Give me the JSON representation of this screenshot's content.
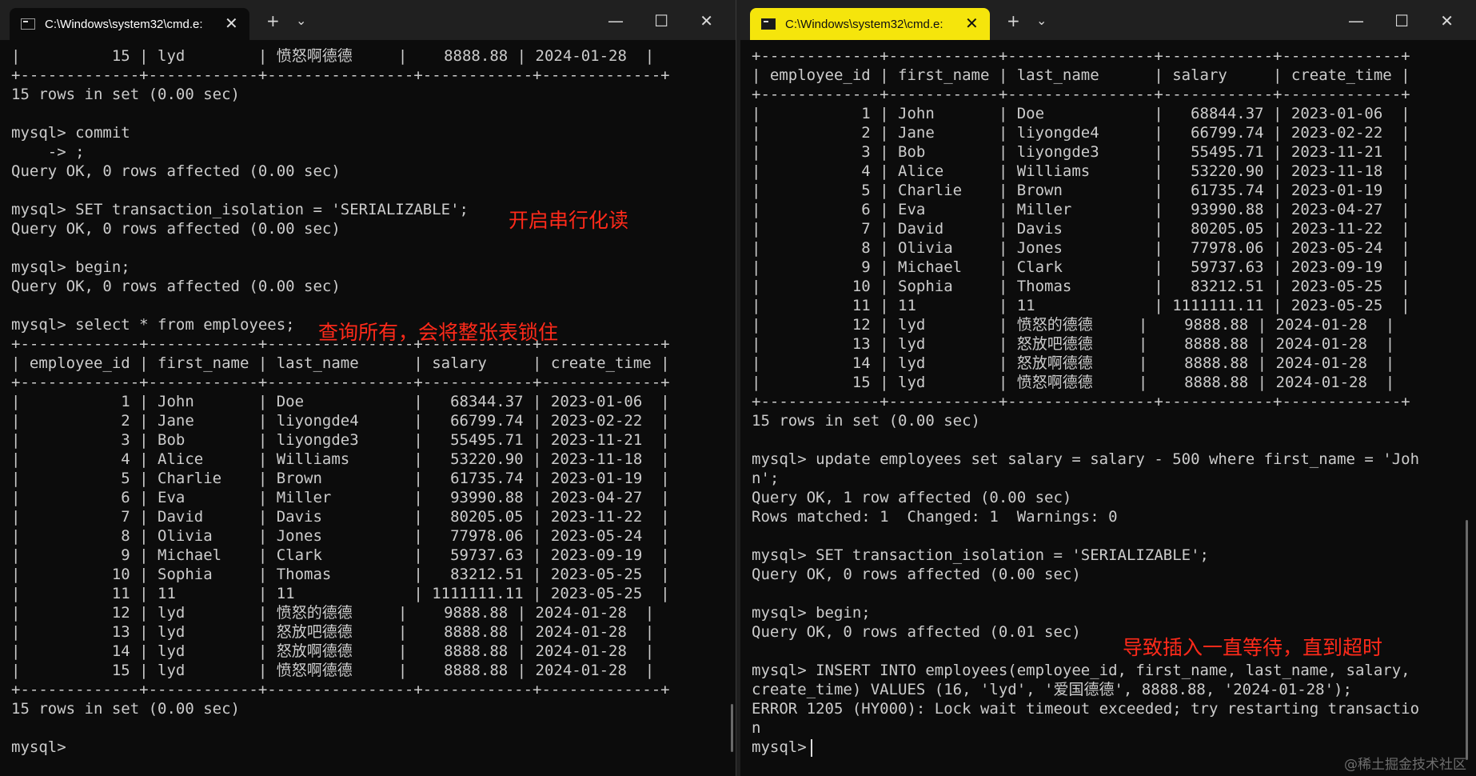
{
  "left_window": {
    "tab_title": "C:\\Windows\\system32\\cmd.e:",
    "tab_close": "✕",
    "new_tab": "+",
    "dropdown": "⌄",
    "minimize": "—",
    "maximize": "☐",
    "close": "✕",
    "lines": [
      "|          15 | lyd        | 愤怒啊德德     |    8888.88 | 2024-01-28  |",
      "+-------------+------------+----------------+------------+-------------+",
      "15 rows in set (0.00 sec)",
      "",
      "mysql> commit",
      "    -> ;",
      "Query OK, 0 rows affected (0.00 sec)",
      "",
      "mysql> SET transaction_isolation = 'SERIALIZABLE';",
      "Query OK, 0 rows affected (0.00 sec)",
      "",
      "mysql> begin;",
      "Query OK, 0 rows affected (0.00 sec)",
      "",
      "mysql> select * from employees;",
      "+-------------+------------+----------------+------------+-------------+",
      "| employee_id | first_name | last_name      | salary     | create_time |",
      "+-------------+------------+----------------+------------+-------------+",
      "|           1 | John       | Doe            |   68344.37 | 2023-01-06  |",
      "|           2 | Jane       | liyongde4      |   66799.74 | 2023-02-22  |",
      "|           3 | Bob        | liyongde3      |   55495.71 | 2023-11-21  |",
      "|           4 | Alice      | Williams       |   53220.90 | 2023-11-18  |",
      "|           5 | Charlie    | Brown          |   61735.74 | 2023-01-19  |",
      "|           6 | Eva        | Miller         |   93990.88 | 2023-04-27  |",
      "|           7 | David      | Davis          |   80205.05 | 2023-11-22  |",
      "|           8 | Olivia     | Jones          |   77978.06 | 2023-05-24  |",
      "|           9 | Michael    | Clark          |   59737.63 | 2023-09-19  |",
      "|          10 | Sophia     | Thomas         |   83212.51 | 2023-05-25  |",
      "|          11 | 11         | 11             | 1111111.11 | 2023-05-25  |",
      "|          12 | lyd        | 愤怒的德德     |    9888.88 | 2024-01-28  |",
      "|          13 | lyd        | 怒放吧德德     |    8888.88 | 2024-01-28  |",
      "|          14 | lyd        | 怒放啊德德     |    8888.88 | 2024-01-28  |",
      "|          15 | lyd        | 愤怒啊德德     |    8888.88 | 2024-01-28  |",
      "+-------------+------------+----------------+------------+-------------+",
      "15 rows in set (0.00 sec)",
      "",
      "mysql>"
    ],
    "annotations": {
      "serializable": "开启串行化读",
      "lock_table": "查询所有，会将整张表锁住"
    }
  },
  "right_window": {
    "tab_title": "C:\\Windows\\system32\\cmd.e:",
    "tab_close": "✕",
    "new_tab": "+",
    "dropdown": "⌄",
    "minimize": "—",
    "maximize": "☐",
    "close": "✕",
    "lines": [
      "+-------------+------------+----------------+------------+-------------+",
      "| employee_id | first_name | last_name      | salary     | create_time |",
      "+-------------+------------+----------------+------------+-------------+",
      "|           1 | John       | Doe            |   68844.37 | 2023-01-06  |",
      "|           2 | Jane       | liyongde4      |   66799.74 | 2023-02-22  |",
      "|           3 | Bob        | liyongde3      |   55495.71 | 2023-11-21  |",
      "|           4 | Alice      | Williams       |   53220.90 | 2023-11-18  |",
      "|           5 | Charlie    | Brown          |   61735.74 | 2023-01-19  |",
      "|           6 | Eva        | Miller         |   93990.88 | 2023-04-27  |",
      "|           7 | David      | Davis          |   80205.05 | 2023-11-22  |",
      "|           8 | Olivia     | Jones          |   77978.06 | 2023-05-24  |",
      "|           9 | Michael    | Clark          |   59737.63 | 2023-09-19  |",
      "|          10 | Sophia     | Thomas         |   83212.51 | 2023-05-25  |",
      "|          11 | 11         | 11             | 1111111.11 | 2023-05-25  |",
      "|          12 | lyd        | 愤怒的德德     |    9888.88 | 2024-01-28  |",
      "|          13 | lyd        | 怒放吧德德     |    8888.88 | 2024-01-28  |",
      "|          14 | lyd        | 怒放啊德德     |    8888.88 | 2024-01-28  |",
      "|          15 | lyd        | 愤怒啊德德     |    8888.88 | 2024-01-28  |",
      "+-------------+------------+----------------+------------+-------------+",
      "15 rows in set (0.00 sec)",
      "",
      "mysql> update employees set salary = salary - 500 where first_name = 'Joh",
      "n';",
      "Query OK, 1 row affected (0.00 sec)",
      "Rows matched: 1  Changed: 1  Warnings: 0",
      "",
      "mysql> SET transaction_isolation = 'SERIALIZABLE';",
      "Query OK, 0 rows affected (0.00 sec)",
      "",
      "mysql> begin;",
      "Query OK, 0 rows affected (0.01 sec)",
      "",
      "mysql> INSERT INTO employees(employee_id, first_name, last_name, salary,",
      "create_time) VALUES (16, 'lyd', '爱国德德', 8888.88, '2024-01-28');",
      "ERROR 1205 (HY000): Lock wait timeout exceeded; try restarting transactio",
      "n",
      "mysql>"
    ],
    "annotations": {
      "insert_wait": "导致插入一直等待，直到超时"
    }
  },
  "watermark": "@稀土掘金技术社区"
}
